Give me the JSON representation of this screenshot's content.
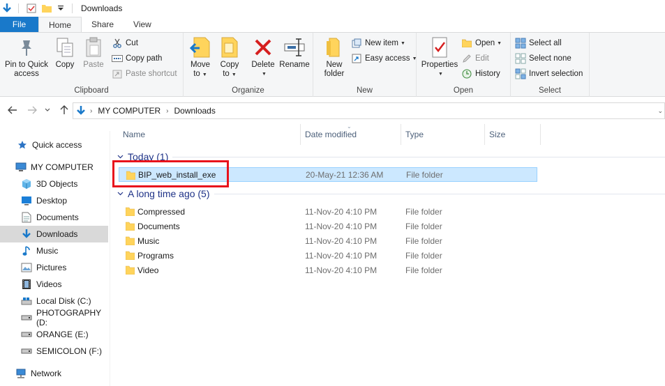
{
  "window": {
    "title": "Downloads"
  },
  "tabs": [
    {
      "label": "File"
    },
    {
      "label": "Home"
    },
    {
      "label": "Share"
    },
    {
      "label": "View"
    }
  ],
  "ribbon": {
    "clipboard": {
      "label": "Clipboard",
      "pin": "Pin to Quick access",
      "pin_line1": "Pin to Quick",
      "pin_line2": "access",
      "copy": "Copy",
      "paste": "Paste",
      "cut": "Cut",
      "copy_path": "Copy path",
      "paste_shortcut": "Paste shortcut"
    },
    "organize": {
      "label": "Organize",
      "move_line1": "Move",
      "move_line2": "to",
      "copyto_line1": "Copy",
      "copyto_line2": "to",
      "delete": "Delete",
      "rename": "Rename"
    },
    "new": {
      "label": "New",
      "folder_line1": "New",
      "folder_line2": "folder",
      "new_item": "New item",
      "easy_access": "Easy access"
    },
    "open": {
      "label": "Open",
      "properties": "Properties",
      "open": "Open",
      "edit": "Edit",
      "history": "History"
    },
    "select": {
      "label": "Select",
      "select_all": "Select all",
      "select_none": "Select none",
      "invert": "Invert selection"
    }
  },
  "address": {
    "crumbs": [
      "MY COMPUTER",
      "Downloads"
    ]
  },
  "navpane": {
    "items": [
      {
        "label": "Quick access",
        "icon": "star-icon"
      },
      {
        "label": "MY COMPUTER",
        "icon": "computer-icon"
      },
      {
        "label": "3D Objects",
        "icon": "cube-icon"
      },
      {
        "label": "Desktop",
        "icon": "desktop-icon"
      },
      {
        "label": "Documents",
        "icon": "document-icon"
      },
      {
        "label": "Downloads",
        "icon": "download-icon"
      },
      {
        "label": "Music",
        "icon": "music-icon"
      },
      {
        "label": "Pictures",
        "icon": "picture-icon"
      },
      {
        "label": "Videos",
        "icon": "video-icon"
      },
      {
        "label": "Local Disk (C:)",
        "icon": "disk-icon"
      },
      {
        "label": "PHOTOGRAPHY (D:",
        "icon": "drive-icon"
      },
      {
        "label": "ORANGE (E:)",
        "icon": "drive-icon"
      },
      {
        "label": "SEMICOLON (F:)",
        "icon": "drive-icon"
      },
      {
        "label": "Network",
        "icon": "network-icon"
      }
    ]
  },
  "columns": {
    "name": "Name",
    "date": "Date modified",
    "type": "Type",
    "size": "Size"
  },
  "groups": [
    {
      "title": "Today (1)",
      "rows": [
        {
          "name": "BIP_web_install_exe",
          "date": "20-May-21 12:36 AM",
          "type": "File folder"
        }
      ]
    },
    {
      "title": "A long time ago (5)",
      "rows": [
        {
          "name": "Compressed",
          "date": "11-Nov-20 4:10 PM",
          "type": "File folder"
        },
        {
          "name": "Documents",
          "date": "11-Nov-20 4:10 PM",
          "type": "File folder"
        },
        {
          "name": "Music",
          "date": "11-Nov-20 4:10 PM",
          "type": "File folder"
        },
        {
          "name": "Programs",
          "date": "11-Nov-20 4:10 PM",
          "type": "File folder"
        },
        {
          "name": "Video",
          "date": "11-Nov-20 4:10 PM",
          "type": "File folder"
        }
      ]
    }
  ],
  "colors": {
    "accent": "#1979ca",
    "selection": "#cce8ff",
    "highlight_box": "#e8131c",
    "folder": "#ffd45c"
  }
}
